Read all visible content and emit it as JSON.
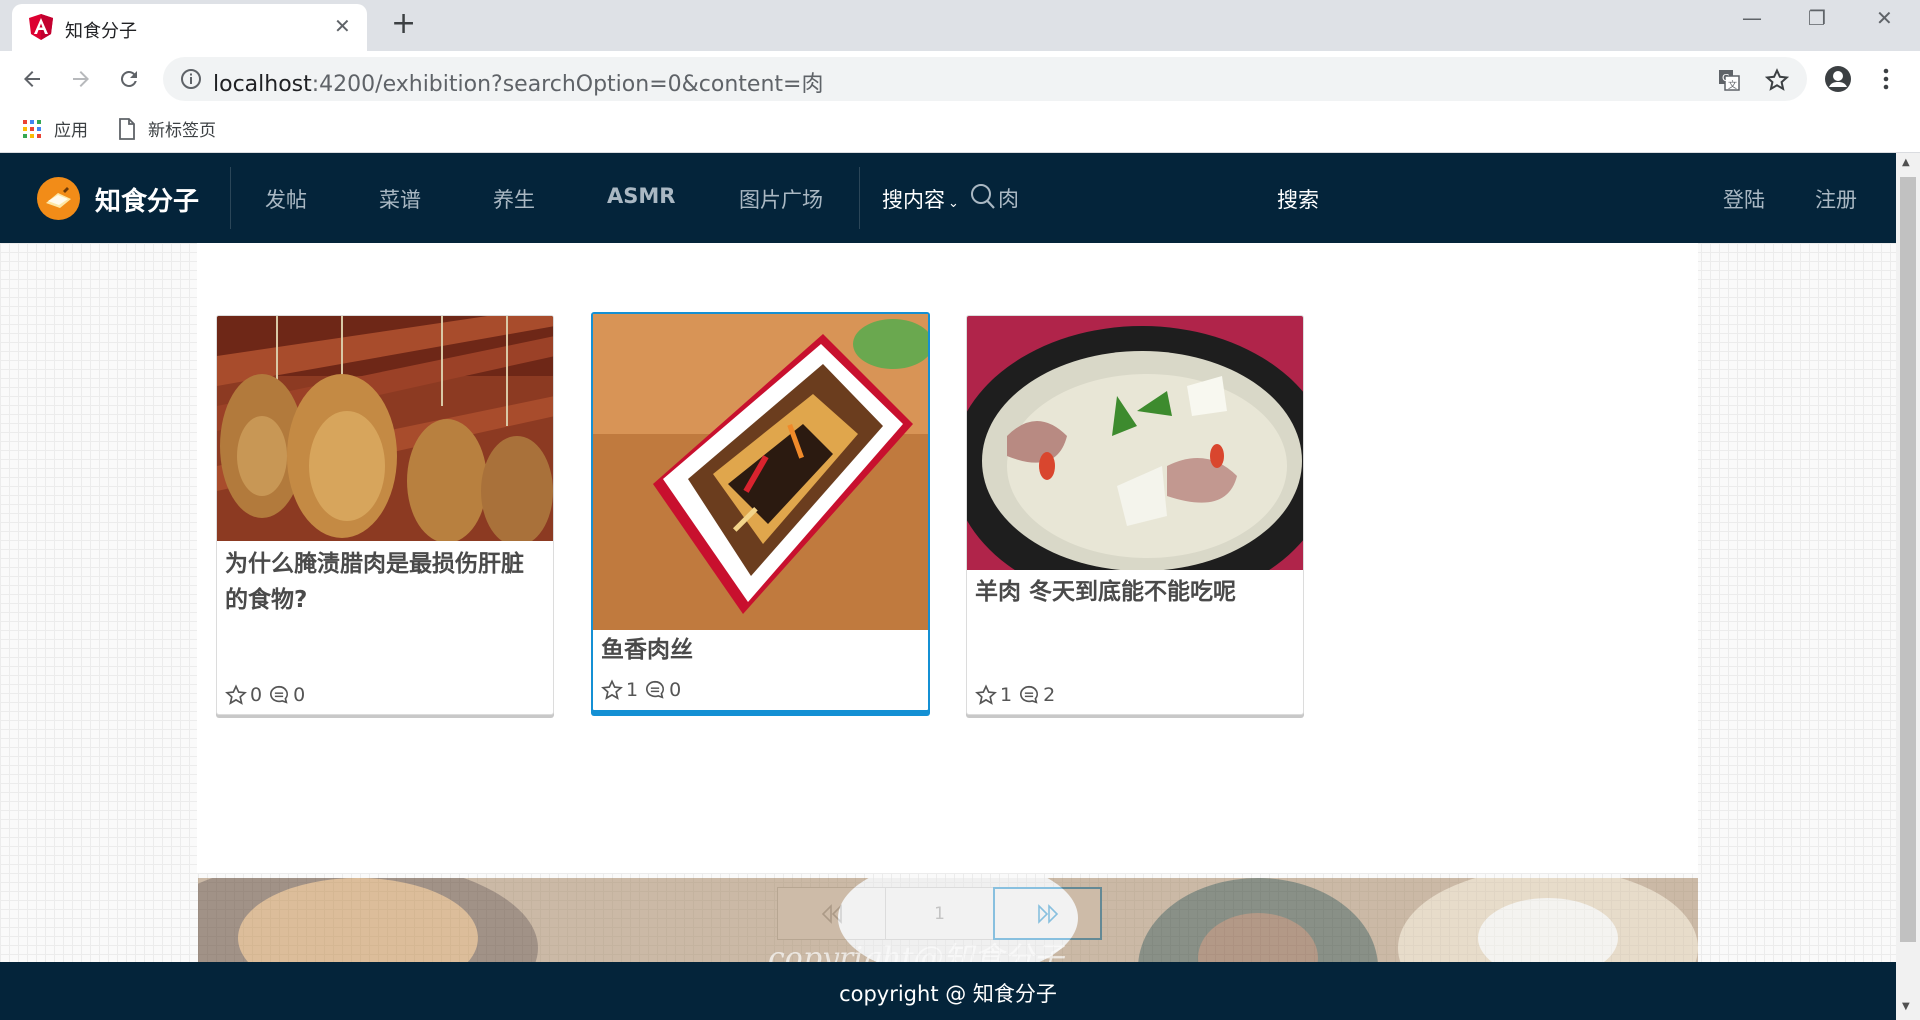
{
  "browser": {
    "tab_title": "知食分子",
    "url_host": "localhost",
    "url_rest": ":4200/exhibition?searchOption=0&content=肉",
    "bookmarks": [
      {
        "label": "应用",
        "icon": "apps-grid-icon"
      },
      {
        "label": "新标签页",
        "icon": "page-icon"
      }
    ]
  },
  "site": {
    "brand": "知食分子",
    "nav": [
      "发帖",
      "菜谱",
      "养生",
      "ASMR",
      "图片广场"
    ],
    "search_option": "搜内容",
    "search_value": "肉",
    "search_button": "搜索",
    "login": "登陆",
    "register": "注册"
  },
  "cards": [
    {
      "title": "为什么腌渍腊肉是最损伤肝脏的食物?",
      "favorites": "0",
      "comments": "0",
      "image": "hanging-cured-ham"
    },
    {
      "title": "鱼香肉丝",
      "favorites": "1",
      "comments": "0",
      "image": "shredded-pork-dish"
    },
    {
      "title": "羊肉 冬天到底能不能吃呢",
      "favorites": "1",
      "comments": "2",
      "image": "mutton-soup"
    }
  ],
  "pagination": {
    "current_page": "1"
  },
  "footer": {
    "text": "copyright @ 知食分子",
    "watermark": "copyright@知食分子"
  },
  "colors": {
    "nav_bg": "#04243a",
    "accent": "#1490d4",
    "logo": "#f28c18"
  }
}
